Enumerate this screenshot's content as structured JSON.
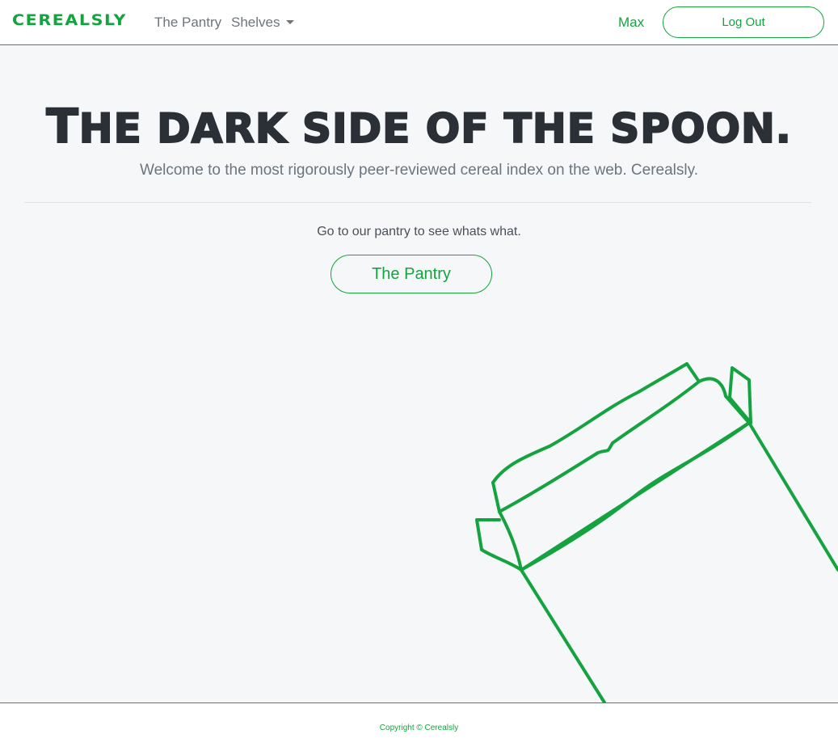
{
  "navbar": {
    "brand": "CEREALSLY",
    "links": [
      {
        "label": "The Pantry"
      },
      {
        "label": "Shelves"
      }
    ],
    "user": "Max",
    "logout_label": "Log Out"
  },
  "hero": {
    "title_first": "T",
    "title_rest": "HE DARK SIDE OF THE SPOON.",
    "lead": "Welcome to the most rigorously peer-reviewed cereal index on the web. Cerealsly.",
    "sub": "Go to our pantry to see whats what.",
    "button_label": "The Pantry"
  },
  "illustration": {
    "name": "cereal-box-outline",
    "stroke_color": "#14a33e"
  },
  "footer": {
    "copyright": "Copyright © Cerealsly"
  },
  "colors": {
    "accent": "#14a33e",
    "background": "#f5f7f9",
    "title": "#2b2f36"
  }
}
